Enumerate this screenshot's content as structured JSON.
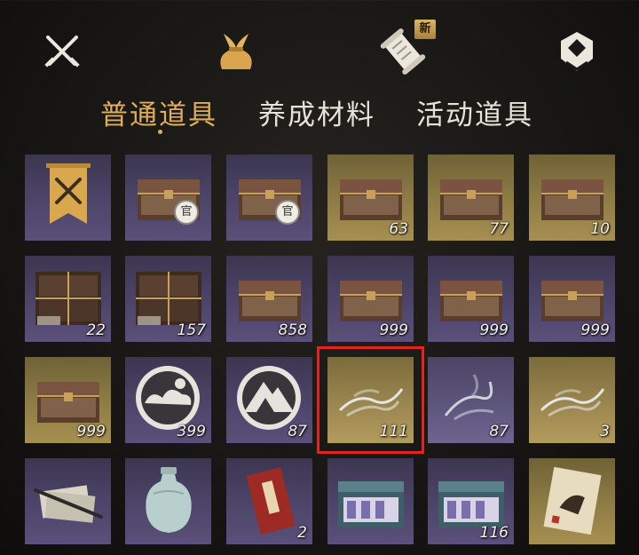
{
  "top_nav": {
    "icons": [
      "crossed-swords-icon",
      "bag-icon",
      "scroll-icon",
      "badge-icon"
    ],
    "new_badge": "新",
    "active_index": 1
  },
  "tabs": [
    {
      "label": "普通道具",
      "active": true
    },
    {
      "label": "养成材料",
      "active": false
    },
    {
      "label": "活动道具",
      "active": false
    }
  ],
  "colors": {
    "accent": "#dcae5e",
    "selection": "#e0241f",
    "rarity_purple": "#4a4366",
    "rarity_gold": "#8d7b45"
  },
  "grid": {
    "selected_index": 15,
    "items": [
      {
        "name": "banner-item",
        "icon": "banner-icon",
        "rarity": "purple",
        "count": ""
      },
      {
        "name": "official-chest",
        "icon": "chest-icon",
        "rarity": "purple",
        "count": "",
        "mark": "官"
      },
      {
        "name": "official-chest",
        "icon": "chest-icon",
        "rarity": "purple",
        "count": "",
        "mark": "官"
      },
      {
        "name": "shell-chest",
        "icon": "chest-icon",
        "rarity": "gold",
        "count": "63"
      },
      {
        "name": "jade-chest",
        "icon": "chest-icon",
        "rarity": "gold",
        "count": "77"
      },
      {
        "name": "armor-chest",
        "icon": "chest-icon",
        "rarity": "gold",
        "count": "10"
      },
      {
        "name": "wooden-cabinet",
        "icon": "cabinet-icon",
        "rarity": "purple",
        "count": "22"
      },
      {
        "name": "wooden-cabinet",
        "icon": "cabinet-icon",
        "rarity": "purple",
        "count": "157"
      },
      {
        "name": "ornate-chest",
        "icon": "chest-icon",
        "rarity": "purple",
        "count": "858"
      },
      {
        "name": "ornate-chest",
        "icon": "chest-icon",
        "rarity": "purple",
        "count": "999"
      },
      {
        "name": "ornate-chest",
        "icon": "chest-icon",
        "rarity": "purple",
        "count": "999"
      },
      {
        "name": "ornate-chest",
        "icon": "chest-icon",
        "rarity": "purple",
        "count": "999"
      },
      {
        "name": "ornate-chest",
        "icon": "chest-icon",
        "rarity": "gold",
        "count": "999"
      },
      {
        "name": "cloud-emblem",
        "icon": "cloud-medal-icon",
        "rarity": "purple",
        "count": "399"
      },
      {
        "name": "mountain-emblem",
        "icon": "mountain-medal-icon",
        "rarity": "purple",
        "count": "87"
      },
      {
        "name": "mist-essence",
        "icon": "mist-icon",
        "rarity": "gold",
        "count": "111"
      },
      {
        "name": "spirit-wisp",
        "icon": "wisp-icon",
        "rarity": "purple",
        "count": "87"
      },
      {
        "name": "golden-mist",
        "icon": "mist-icon",
        "rarity": "gold",
        "count": "3"
      },
      {
        "name": "brush-and-paper",
        "icon": "brush-icon",
        "rarity": "purple",
        "count": ""
      },
      {
        "name": "celadon-vase",
        "icon": "vase-icon",
        "rarity": "purple",
        "count": ""
      },
      {
        "name": "red-booklet",
        "icon": "booklet-icon",
        "rarity": "purple",
        "count": "2"
      },
      {
        "name": "fabric-box",
        "icon": "gift-box-icon",
        "rarity": "purple",
        "count": ""
      },
      {
        "name": "pastry-box",
        "icon": "gift-box-icon",
        "rarity": "purple",
        "count": "116"
      },
      {
        "name": "horse-painting",
        "icon": "painting-icon",
        "rarity": "gold",
        "count": ""
      }
    ]
  }
}
